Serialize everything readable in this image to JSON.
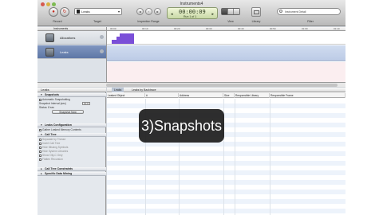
{
  "window": {
    "title": "Instruments4"
  },
  "toolbar": {
    "record_caption": "Record",
    "target_caption": "Target",
    "target_value": "Leaks",
    "inspection_caption": "Inspection Range",
    "view_caption": "View",
    "library_caption": "Library",
    "filter_caption": "Filter",
    "search_placeholder": "Instrument Detail",
    "lcd": {
      "time": "00:00:09",
      "run": "Run 1 of 1"
    }
  },
  "instruments": {
    "header": "Instruments",
    "tracks": [
      {
        "label": "Allocations",
        "icon": "allocations-icon"
      },
      {
        "label": "Leaks",
        "icon": "leaks-icon",
        "selected": true
      }
    ]
  },
  "ruler": {
    "ticks": [
      "00:00",
      "00:10",
      "00:20",
      "00:30",
      "00:40",
      "00:50",
      "01:00",
      "01:10"
    ]
  },
  "detail": {
    "header": "Leaks",
    "sections": {
      "snapshots": "Snapshots",
      "leaks_configuration": "Leaks Configuration",
      "call_tree": "Call Tree",
      "call_tree_constraints": "Call Tree Constraints",
      "specific_data_mining": "Specific Data Mining"
    },
    "snapshots": {
      "automatic": "Automatic Snapshotting",
      "interval_label": "Snapshot Interval (sec)",
      "interval_value": "10.0",
      "status_label": "Status:",
      "status_value": "8 sec",
      "snapshot_now": "Snapshot Now"
    },
    "leaks_configuration": {
      "gather": "Gather Leaked Memory Contents"
    },
    "call_tree": {
      "options": [
        "Separate by Thread",
        "Invert Call Tree",
        "Hide Missing Symbols",
        "Hide System Libraries",
        "Show Obj-C Only",
        "Flatten Recursion"
      ]
    },
    "tabs": [
      "Leaks",
      "Leaks by Backtrace"
    ],
    "columns": [
      "Leaked Object",
      "#",
      "Address",
      "Size",
      "Responsible Library",
      "Responsible Frame"
    ]
  },
  "overlay": {
    "caption": "3)Snapshots"
  },
  "colors": {
    "selection": "#5e77a6",
    "lane_leaks": "#c6d3ea",
    "alloc_graph": "#7a4fd8",
    "overlay_bg": "#1c1c1c"
  }
}
